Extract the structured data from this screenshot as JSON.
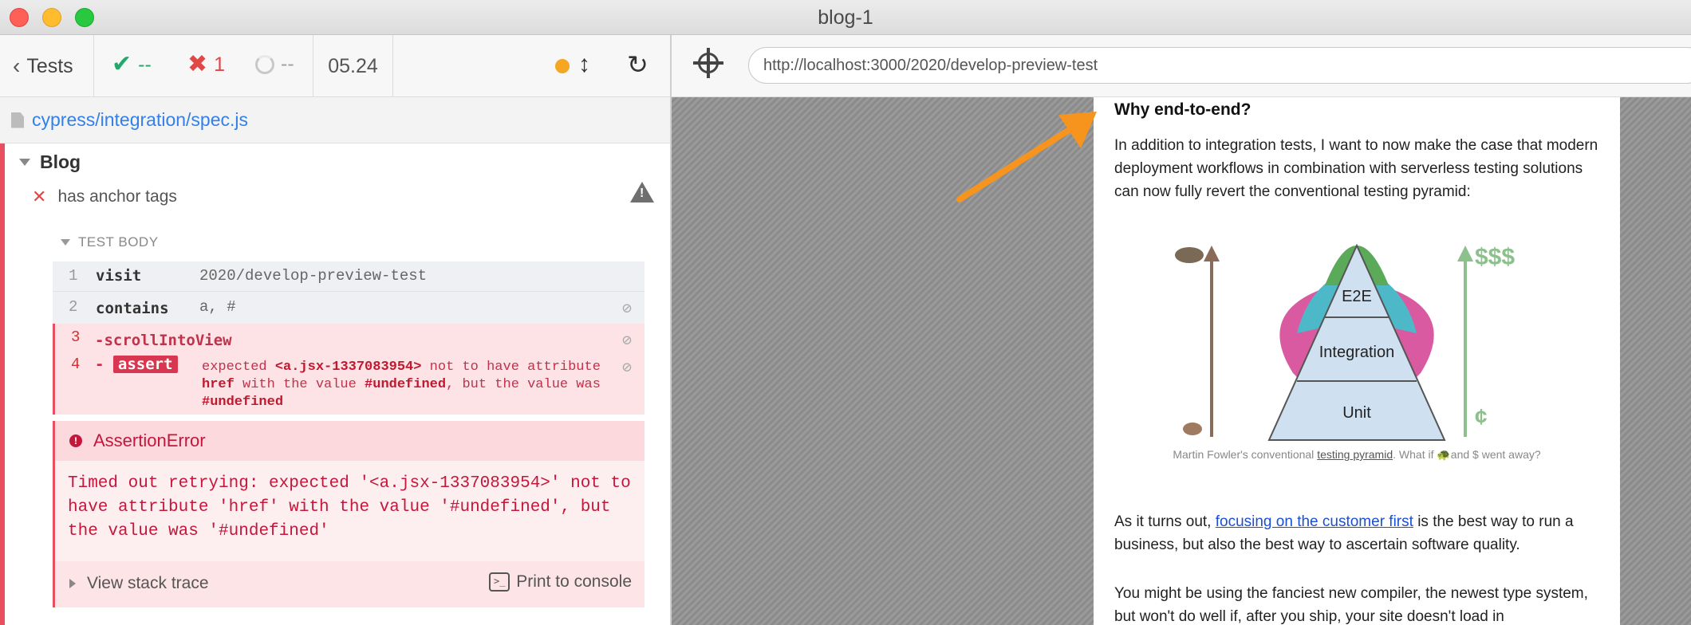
{
  "window": {
    "title": "blog-1"
  },
  "reporter": {
    "back_label": "Tests",
    "stats": {
      "passed": "--",
      "failed": "1",
      "pending": "--",
      "duration": "05.24"
    },
    "spec_path": "cypress/integration/spec.js",
    "suite_title": "Blog",
    "test_title": "has anchor tags",
    "test_body_label": "TEST BODY",
    "commands": [
      {
        "num": "1",
        "name": "visit",
        "message": "2020/develop-preview-test"
      },
      {
        "num": "2",
        "name": "contains",
        "message": "a, #"
      },
      {
        "num": "3",
        "name": "-scrollIntoView",
        "message": ""
      },
      {
        "num": "4",
        "name_prefix": "-",
        "name": "assert",
        "msg_parts": [
          "expected",
          "<a.jsx-1337083954>",
          "not to have attribute",
          "href",
          "with the value",
          "#undefined",
          ", but the value was",
          "#undefined"
        ]
      }
    ],
    "error": {
      "title": "AssertionError",
      "message": "Timed out retrying: expected '<a.jsx-1337083954>' not to have attribute 'href' with the value '#undefined', but the value was '#undefined'",
      "stack_label": "View stack trace",
      "print_label": "Print to console"
    }
  },
  "preview": {
    "url": "http://localhost:3000/2020/develop-preview-test",
    "heading": "Why end-to-end?",
    "p1": "In addition to integration tests, I want to now make the case that modern deployment workflows in combination with serverless testing solutions can now fully revert the conventional testing pyramid:",
    "pyramid": {
      "top": "E2E",
      "middle": "Integration",
      "bottom": "Unit",
      "cost_high": "$$$",
      "cost_low": "¢"
    },
    "caption": {
      "pre": "Martin Fowler's conventional",
      "link": "testing pyramid",
      "post": ". What if 🐢and $ went away?"
    },
    "p2": {
      "pre": "As it turns out,",
      "link": "focusing on the customer first",
      "post": "is the best way to run a business, but also the best way to ascertain software quality."
    },
    "p3": "You might be using the fanciest new compiler, the newest type system, but won't do well if, after you ship, your site doesn't load in"
  },
  "colors": {
    "accent_blue": "#3380ea",
    "fail_red": "#e94f5f",
    "annotation_orange": "#f7941d"
  }
}
